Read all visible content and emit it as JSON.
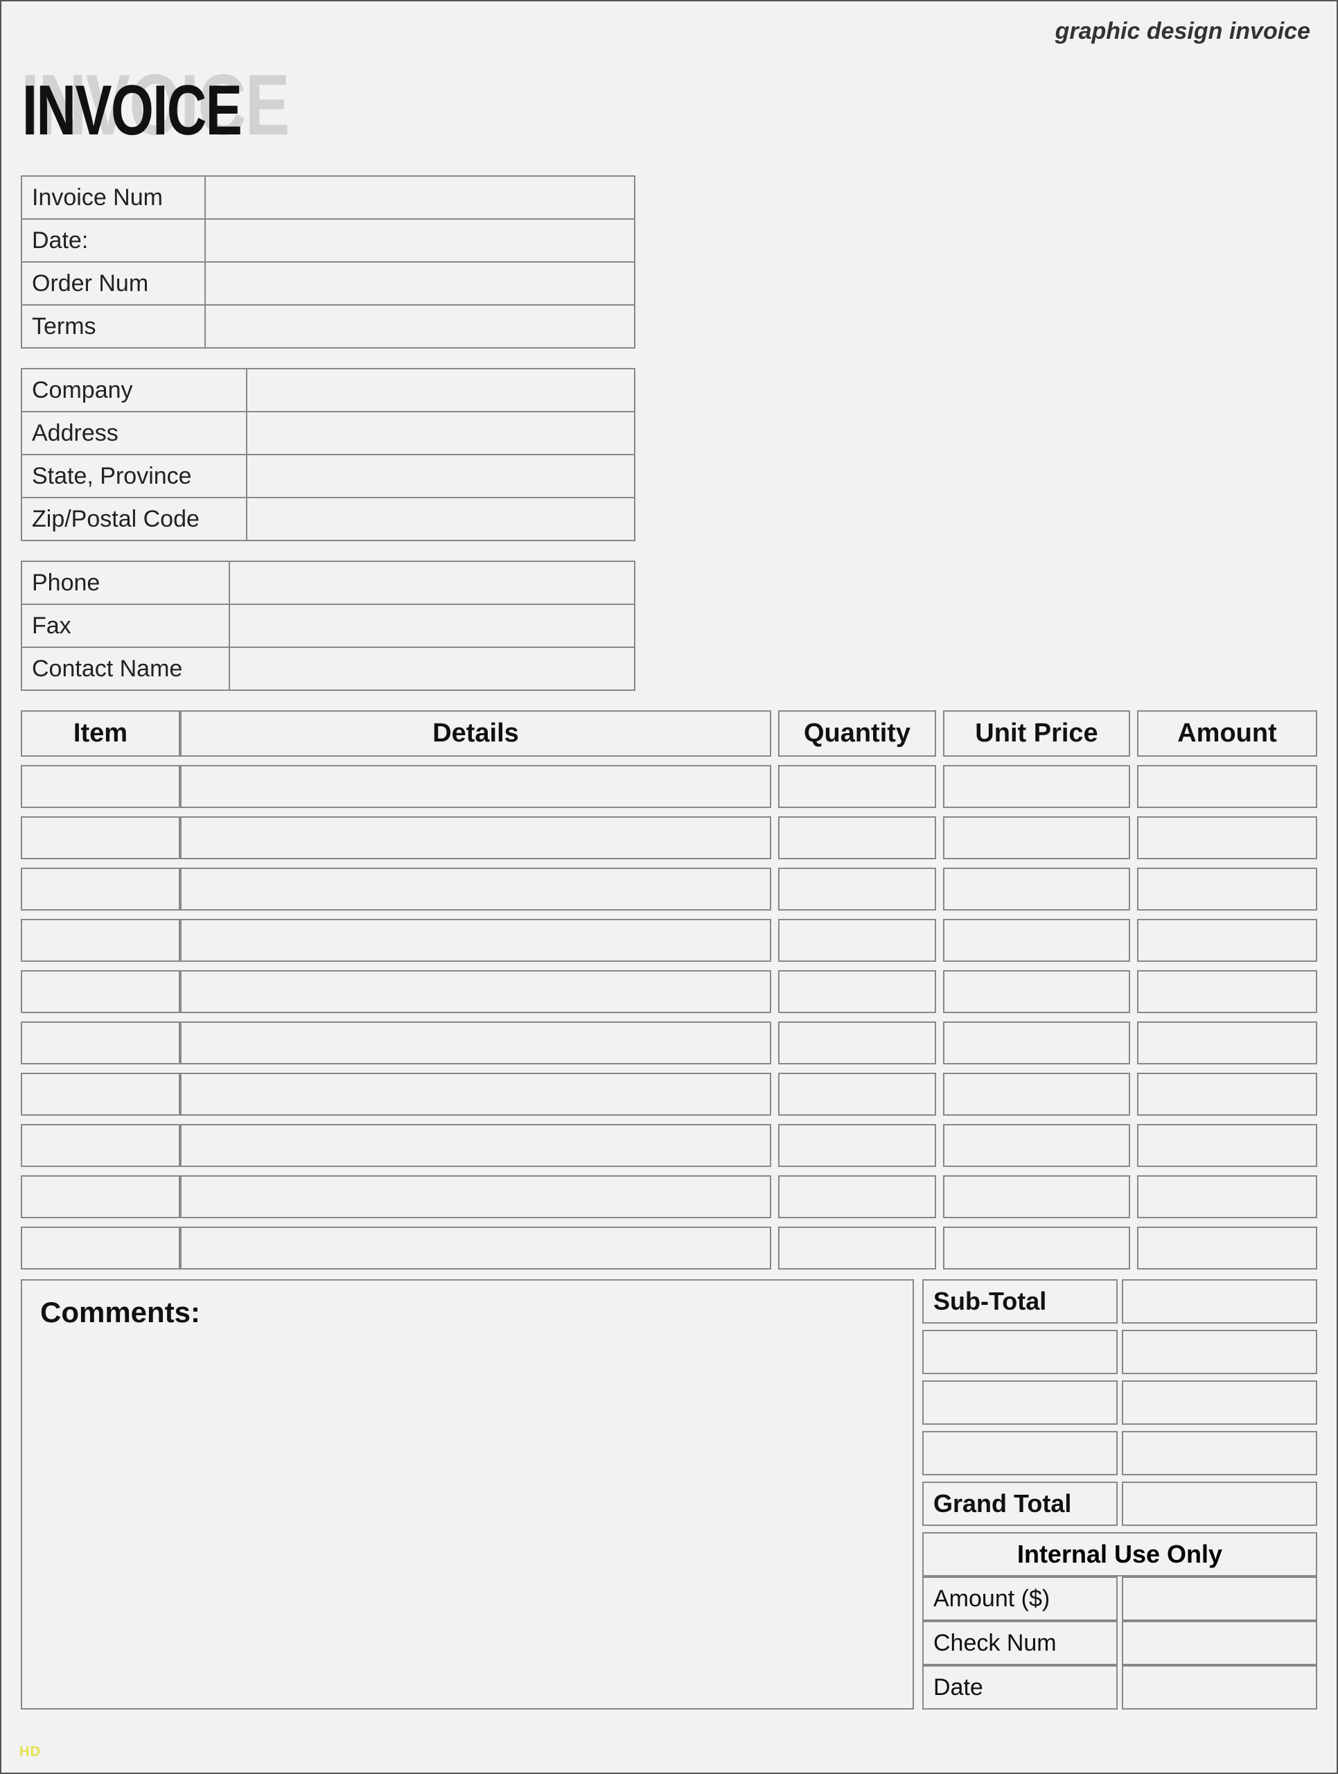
{
  "header": {
    "top_label": "graphic design invoice",
    "title": "INVOICE"
  },
  "info1": {
    "invoice_num_label": "Invoice Num",
    "invoice_num_value": "",
    "date_label": "Date:",
    "date_value": "",
    "order_num_label": "Order Num",
    "order_num_value": "",
    "terms_label": "Terms",
    "terms_value": ""
  },
  "info2": {
    "company_label": "Company",
    "company_value": "",
    "address_label": "Address",
    "address_value": "",
    "state_label": "State, Province",
    "state_value": "",
    "zip_label": "Zip/Postal Code",
    "zip_value": ""
  },
  "info3": {
    "phone_label": "Phone",
    "phone_value": "",
    "fax_label": "Fax",
    "fax_value": "",
    "contact_label": "Contact Name",
    "contact_value": ""
  },
  "items_table": {
    "headers": {
      "item": "Item",
      "details": "Details",
      "qty": "Quantity",
      "price": "Unit Price",
      "amount": "Amount"
    },
    "rows": [
      {
        "item": "",
        "details": "",
        "qty": "",
        "price": "",
        "amount": ""
      },
      {
        "item": "",
        "details": "",
        "qty": "",
        "price": "",
        "amount": ""
      },
      {
        "item": "",
        "details": "",
        "qty": "",
        "price": "",
        "amount": ""
      },
      {
        "item": "",
        "details": "",
        "qty": "",
        "price": "",
        "amount": ""
      },
      {
        "item": "",
        "details": "",
        "qty": "",
        "price": "",
        "amount": ""
      },
      {
        "item": "",
        "details": "",
        "qty": "",
        "price": "",
        "amount": ""
      },
      {
        "item": "",
        "details": "",
        "qty": "",
        "price": "",
        "amount": ""
      },
      {
        "item": "",
        "details": "",
        "qty": "",
        "price": "",
        "amount": ""
      },
      {
        "item": "",
        "details": "",
        "qty": "",
        "price": "",
        "amount": ""
      },
      {
        "item": "",
        "details": "",
        "qty": "",
        "price": "",
        "amount": ""
      }
    ]
  },
  "comments": {
    "label": "Comments:"
  },
  "totals": {
    "subtotal_label": "Sub-Total",
    "subtotal_value": "",
    "extra1_l": "",
    "extra1_r": "",
    "extra2_l": "",
    "extra2_r": "",
    "extra3_l": "",
    "extra3_r": "",
    "grandtotal_label": "Grand Total",
    "grandtotal_value": "",
    "internal_label": "Internal Use Only",
    "amount_label": "Amount ($)",
    "amount_value": "",
    "check_label": "Check Num",
    "check_value": "",
    "date_label": "Date",
    "date_value": ""
  },
  "watermark": "HD"
}
